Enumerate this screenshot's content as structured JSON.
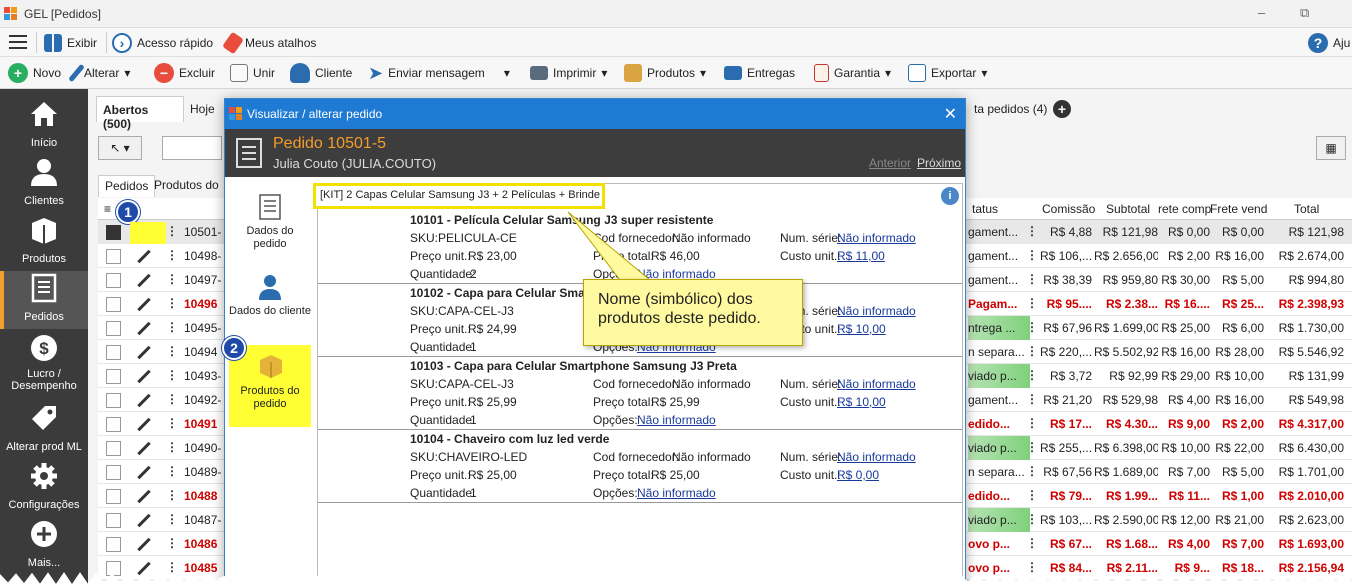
{
  "window": {
    "title": "GEL [Pedidos]",
    "minimize": "–",
    "restore": "⧉"
  },
  "menubar": {
    "view": "Exibir",
    "quick_access": "Acesso rápido",
    "shortcuts": "Meus atalhos",
    "help": "Aju"
  },
  "toolbar": {
    "new": "Novo",
    "edit": "Alterar",
    "delete": "Excluir",
    "merge": "Unir",
    "client": "Cliente",
    "send_message": "Enviar mensagem",
    "print": "Imprimir",
    "products": "Produtos",
    "deliveries": "Entregas",
    "warranty": "Garantia",
    "export": "Exportar"
  },
  "sidebar": {
    "items": [
      {
        "label": "Início"
      },
      {
        "label": "Clientes"
      },
      {
        "label": "Produtos"
      },
      {
        "label": "Pedidos"
      },
      {
        "label": "Lucro / Desempenho"
      },
      {
        "label": "Alterar prod ML"
      },
      {
        "label": "Configurações"
      },
      {
        "label": "Mais..."
      }
    ]
  },
  "tabs": {
    "open": "Abertos (500)",
    "today": "Hoje",
    "list_orders": "ta pedidos (4)"
  },
  "subtabs": {
    "orders": "Pedidos",
    "products": "Produtos do"
  },
  "grid": {
    "headers": {
      "status": "tatus",
      "commission": "Comissão",
      "subtotal": "Subtotal",
      "freight_buy": "rete comp",
      "freight_sell": "Frete vend",
      "total": "Total"
    },
    "rows": [
      {
        "id": "10501-",
        "red": false,
        "status": "gament...",
        "commission": "R$ 4,88",
        "subtotal": "R$ 121,98",
        "fc": "R$ 0,00",
        "fv": "R$ 0,00",
        "total": "R$ 121,98"
      },
      {
        "id": "10498-",
        "red": false,
        "status": "gament...",
        "commission": "R$ 106,...",
        "subtotal": "R$ 2.656,00",
        "fc": "R$ 2,00",
        "fv": "R$ 16,00",
        "total": "R$ 2.674,00"
      },
      {
        "id": "10497-",
        "red": false,
        "status": "gament...",
        "commission": "R$ 38,39",
        "subtotal": "R$ 959,80",
        "fc": "R$ 30,00",
        "fv": "R$ 5,00",
        "total": "R$ 994,80"
      },
      {
        "id": "10496",
        "red": true,
        "status": "Pagam...",
        "commission": "R$ 95....",
        "subtotal": "R$ 2.38...",
        "fc": "R$ 16....",
        "fv": "R$ 25...",
        "total": "R$ 2.398,93"
      },
      {
        "id": "10495-",
        "red": false,
        "status": "ntrega ...",
        "commission": "R$ 67,96",
        "subtotal": "R$ 1.699,00",
        "fc": "R$ 25,00",
        "fv": "R$ 6,00",
        "total": "R$ 1.730,00"
      },
      {
        "id": "10494",
        "red": false,
        "status": "n separa...",
        "commission": "R$ 220,...",
        "subtotal": "R$ 5.502,92",
        "fc": "R$ 16,00",
        "fv": "R$ 28,00",
        "total": "R$ 5.546,92"
      },
      {
        "id": "10493-",
        "red": false,
        "status": "viado p...",
        "commission": "R$ 3,72",
        "subtotal": "R$ 92,99",
        "fc": "R$ 29,00",
        "fv": "R$ 10,00",
        "total": "R$ 131,99"
      },
      {
        "id": "10492-",
        "red": false,
        "status": "gament...",
        "commission": "R$ 21,20",
        "subtotal": "R$ 529,98",
        "fc": "R$ 4,00",
        "fv": "R$ 16,00",
        "total": "R$ 549,98"
      },
      {
        "id": "10491",
        "red": true,
        "status": "edido...",
        "commission": "R$ 17...",
        "subtotal": "R$ 4.30...",
        "fc": "R$ 9,00",
        "fv": "R$ 2,00",
        "total": "R$ 4.317,00"
      },
      {
        "id": "10490-",
        "red": false,
        "status": "viado p...",
        "commission": "R$ 255,...",
        "subtotal": "R$ 6.398,00",
        "fc": "R$ 10,00",
        "fv": "R$ 22,00",
        "total": "R$ 6.430,00"
      },
      {
        "id": "10489-",
        "red": false,
        "status": "n separa...",
        "commission": "R$ 67,56",
        "subtotal": "R$ 1.689,00",
        "fc": "R$ 7,00",
        "fv": "R$ 5,00",
        "total": "R$ 1.701,00"
      },
      {
        "id": "10488",
        "red": true,
        "status": "edido...",
        "commission": "R$ 79...",
        "subtotal": "R$ 1.99...",
        "fc": "R$ 11...",
        "fv": "R$ 1,00",
        "total": "R$ 2.010,00"
      },
      {
        "id": "10487-",
        "red": false,
        "status": "viado p...",
        "commission": "R$ 103,...",
        "subtotal": "R$ 2.590,00",
        "fc": "R$ 12,00",
        "fv": "R$ 21,00",
        "total": "R$ 2.623,00"
      },
      {
        "id": "10486",
        "red": true,
        "status": "ovo p...",
        "commission": "R$ 67...",
        "subtotal": "R$ 1.68...",
        "fc": "R$ 4,00",
        "fv": "R$ 7,00",
        "total": "R$ 1.693,00"
      },
      {
        "id": "10485",
        "red": true,
        "status": "ovo p...",
        "commission": "R$ 84...",
        "subtotal": "R$ 2.11...",
        "fc": "R$ 9...",
        "fv": "R$ 18...",
        "total": "R$ 2.156,94"
      }
    ]
  },
  "modal": {
    "title": "Visualizar / alterar pedido",
    "close": "✕",
    "order_title": "Pedido 10501-5",
    "order_sub": "Julia Couto (JULIA.COUTO)",
    "prev": "Anterior",
    "next": "Próximo",
    "nav": [
      {
        "label": "Dados do pedido"
      },
      {
        "label": "Dados do cliente"
      },
      {
        "label": "Produtos do pedido"
      }
    ],
    "kit_name": "[KIT] 2 Capas Celular Samsung J3 + 2 Películas + Brinde",
    "info": "i",
    "labels": {
      "sku": "SKU:",
      "unit_price": "Preço unit.:",
      "qty": "Quantidade:",
      "supplier_code": "Cod fornecedor:",
      "total_price": "Preço total:",
      "options": "Opções:",
      "serial": "Num. série:",
      "unit_cost": "Custo unit.:"
    },
    "products": [
      {
        "name": "10101 - Película Celular Samsung J3 super resistente",
        "sku": "PELICULA-CE",
        "unit_price": "R$ 23,00",
        "qty": "2",
        "supplier_code": "Não informado",
        "total_price": "R$ 46,00",
        "options": "Não informado",
        "serial": "Não informado",
        "unit_cost": "R$ 11,00"
      },
      {
        "name": "10102 - Capa para Celular Sma",
        "sku": "CAPA-CEL-J3",
        "unit_price": "R$ 24,99",
        "qty": "1",
        "supplier_code": "",
        "total_price": "",
        "options": "Não informado",
        "serial": "Não informado",
        "unit_cost": "R$ 10,00"
      },
      {
        "name": "10103 - Capa para Celular Smartphone Samsung J3 Preta",
        "sku": "CAPA-CEL-J3",
        "unit_price": "R$ 25,99",
        "qty": "1",
        "supplier_code": "Não informado",
        "total_price": "R$ 25,99",
        "options": "Não informado",
        "serial": "Não informado",
        "unit_cost": "R$ 10,00"
      },
      {
        "name": "10104 - Chaveiro com luz led verde",
        "sku": "CHAVEIRO-LED",
        "unit_price": "R$ 25,00",
        "qty": "1",
        "supplier_code": "Não informado",
        "total_price": "R$ 25,00",
        "options": "Não informado",
        "serial": "Não informado",
        "unit_cost": "R$ 0,00"
      }
    ]
  },
  "callout": {
    "text": "Nome (simbólico) dos produtos deste pedido."
  },
  "markers": {
    "one": "1",
    "two": "2"
  },
  "colors": {
    "accent": "#1f7ad3",
    "orange": "#f39c2a",
    "highlight": "#ffff33",
    "red": "#d00000",
    "sidebar": "#3b3b3b"
  }
}
